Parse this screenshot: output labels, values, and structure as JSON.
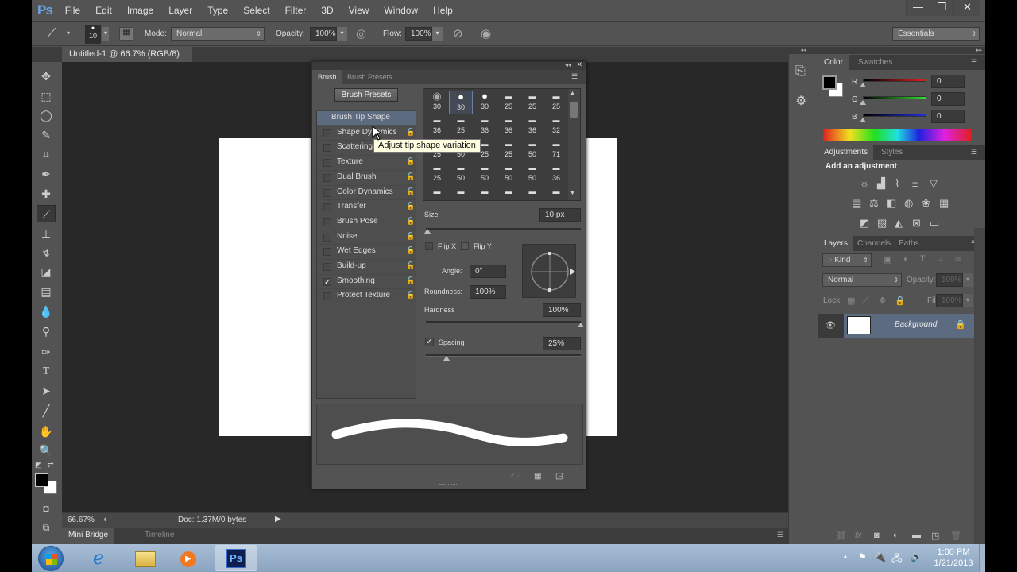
{
  "app": {
    "logo": "Ps",
    "menu": [
      "File",
      "Edit",
      "Image",
      "Layer",
      "Type",
      "Select",
      "Filter",
      "3D",
      "View",
      "Window",
      "Help"
    ],
    "window_buttons": {
      "minimize": "—",
      "restore": "❐",
      "close": "✕"
    }
  },
  "options_bar": {
    "brush_size": "10",
    "mode_label": "Mode:",
    "mode_value": "Normal",
    "opacity_label": "Opacity:",
    "opacity_value": "100%",
    "flow_label": "Flow:",
    "flow_value": "100%",
    "workspace": "Essentials"
  },
  "document": {
    "tab_title": "Untitled-1 @ 66.7% (RGB/8)",
    "tab_close": "×",
    "zoom": "66.67%",
    "doc_info": "Doc: 1.37M/0 bytes"
  },
  "bottom_tabs": [
    "Mini Bridge",
    "Timeline"
  ],
  "brush_panel": {
    "tabs": [
      "Brush",
      "Brush Presets"
    ],
    "presets_button": "Brush Presets",
    "options": [
      {
        "label": "Brush Tip Shape",
        "selected": true,
        "checked": null
      },
      {
        "label": "Shape Dynamics",
        "checked": false
      },
      {
        "label": "Scattering",
        "checked": false
      },
      {
        "label": "Texture",
        "checked": false
      },
      {
        "label": "Dual Brush",
        "checked": false
      },
      {
        "label": "Color Dynamics",
        "checked": false
      },
      {
        "label": "Transfer",
        "checked": false
      },
      {
        "label": "Brush Pose",
        "checked": false
      },
      {
        "label": "Noise",
        "checked": false
      },
      {
        "label": "Wet Edges",
        "checked": false
      },
      {
        "label": "Build-up",
        "checked": false
      },
      {
        "label": "Smoothing",
        "checked": true
      },
      {
        "label": "Protect Texture",
        "checked": false
      }
    ],
    "tip_sizes": [
      [
        "30",
        "30",
        "30",
        "25",
        "25",
        "25"
      ],
      [
        "36",
        "25",
        "36",
        "36",
        "36",
        "32"
      ],
      [
        "25",
        "50",
        "25",
        "25",
        "50",
        "71"
      ],
      [
        "25",
        "50",
        "50",
        "50",
        "50",
        "36"
      ]
    ],
    "size_label": "Size",
    "size_value": "10 px",
    "size_slider_fraction": 0.01,
    "flip_x": "Flip X",
    "flip_y": "Flip Y",
    "angle_label": "Angle:",
    "angle_value": "0°",
    "roundness_label": "Roundness:",
    "roundness_value": "100%",
    "hardness_label": "Hardness",
    "hardness_value": "100%",
    "hardness_fraction": 1.0,
    "spacing_label": "Spacing",
    "spacing_value": "25%",
    "spacing_checked": true,
    "tooltip": "Adjust tip shape variation"
  },
  "color_panel": {
    "tabs": [
      "Color",
      "Swatches"
    ],
    "channels": [
      {
        "label": "R",
        "value": "0",
        "color": "#e02020"
      },
      {
        "label": "G",
        "value": "0",
        "color": "#30e030"
      },
      {
        "label": "B",
        "value": "0",
        "color": "#2030e0"
      }
    ],
    "foreground": "#000000",
    "background": "#ffffff"
  },
  "adjustments_panel": {
    "tabs": [
      "Adjustments",
      "Styles"
    ],
    "heading": "Add an adjustment",
    "icons_row1": [
      "brightness-icon",
      "levels-icon",
      "curves-icon",
      "exposure-icon",
      "vibrance-icon"
    ],
    "icons_row2": [
      "hue-sat-icon",
      "color-balance-icon",
      "black-white-icon",
      "photo-filter-icon",
      "channel-mixer-icon",
      "color-lookup-icon"
    ],
    "icons_row3": [
      "invert-icon",
      "posterize-icon",
      "threshold-icon",
      "selective-color-icon",
      "gradient-map-icon"
    ]
  },
  "layers_panel": {
    "tabs": [
      "Layers",
      "Channels",
      "Paths"
    ],
    "filter_kind": "Kind",
    "blend_mode": "Normal",
    "opacity_label": "Opacity:",
    "opacity_value": "100%",
    "lock_label": "Lock:",
    "fill_label": "Fill:",
    "fill_value": "100%",
    "layers": [
      {
        "name": "Background",
        "visible": true,
        "locked": true
      }
    ]
  },
  "taskbar": {
    "time": "1:00 PM",
    "date": "1/21/2013",
    "active_app": "Ps"
  }
}
